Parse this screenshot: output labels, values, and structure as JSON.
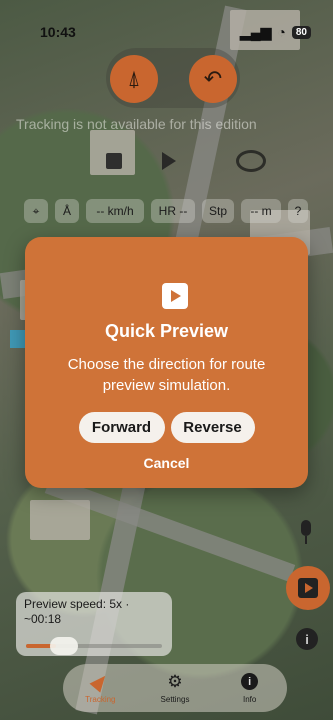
{
  "status_bar": {
    "time": "10:43",
    "battery": "80"
  },
  "top_controls": {
    "compass_icon": "navigation-arrow",
    "undo_icon": "undo-arrow"
  },
  "tracking_message": "Tracking is not available for this edition",
  "filter_chips": [
    {
      "id": "locate",
      "label": "⌖"
    },
    {
      "id": "heading",
      "label": "Å"
    },
    {
      "id": "speed",
      "label": "-- km/h"
    },
    {
      "id": "heart-rate",
      "label": "HR --"
    },
    {
      "id": "steps",
      "label": "Stp"
    },
    {
      "id": "distance",
      "label": "-- m"
    },
    {
      "id": "help",
      "label": "?"
    }
  ],
  "dialog": {
    "title": "Quick Preview",
    "message": "Choose the direction for route preview simulation.",
    "forward_label": "Forward",
    "reverse_label": "Reverse",
    "cancel_label": "Cancel"
  },
  "speed_panel": {
    "line1": "Preview speed: 5x ·",
    "line2": "~00:18",
    "progress": 0.22
  },
  "tabs": [
    {
      "id": "tracking",
      "label": "Tracking",
      "active": true
    },
    {
      "id": "settings",
      "label": "Settings",
      "active": false
    },
    {
      "id": "info",
      "label": "Info",
      "active": false
    }
  ],
  "colors": {
    "accent": "#c9662f",
    "dialog_bg": "#cf7338"
  }
}
